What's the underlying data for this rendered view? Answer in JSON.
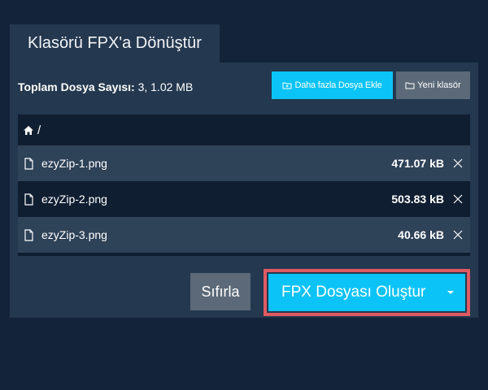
{
  "tab": {
    "title": "Klasörü FPX'a Dönüştür"
  },
  "summary": {
    "label": "Toplam Dosya Sayısı:",
    "value": "3, 1.02 MB"
  },
  "toolbar": {
    "add_more_label": "Daha fazla Dosya Ekle",
    "new_folder_label": "Yeni klasör"
  },
  "path": "/",
  "files": [
    {
      "name": "ezyZip-1.png",
      "size": "471.07 kB"
    },
    {
      "name": "ezyZip-2.png",
      "size": "503.83 kB"
    },
    {
      "name": "ezyZip-3.png",
      "size": "40.66 kB"
    }
  ],
  "actions": {
    "reset_label": "Sıfırla",
    "convert_label": "FPX Dosyası Oluştur"
  },
  "colors": {
    "background": "#13243a",
    "panel": "#24384f",
    "accent": "#0bc3f7",
    "secondary_button": "#5b6978",
    "highlight_border": "#e05a62"
  },
  "icons": {
    "home": "home-icon",
    "file": "file-icon",
    "remove": "close-icon",
    "add_folder": "folder-add-icon",
    "new_folder": "folder-icon",
    "dropdown": "caret-down-icon"
  }
}
